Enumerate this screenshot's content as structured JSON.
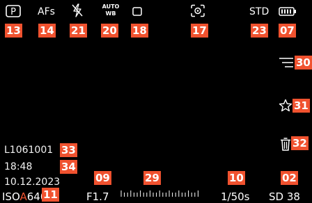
{
  "top_bar": {
    "exposure_mode": "P",
    "focus_mode": "AFs",
    "white_balance_top": "AUTO",
    "white_balance_bottom": "WB",
    "film_style": "STD"
  },
  "right_bar": {
    "menu_icon": "filter-lines-icon",
    "favorite_icon": "star-icon",
    "delete_icon": "trash-icon"
  },
  "bottom_left": {
    "file_name": "L1061001",
    "time": "18:48",
    "date": "10.12.2023"
  },
  "bottom_bar": {
    "iso_prefix": "ISO",
    "iso_auto_marker": "A",
    "iso_value": "640",
    "aperture": "F1.7",
    "shutter_speed": "1/50s",
    "storage": "SD",
    "storage_count": "38"
  },
  "annotations": {
    "b13": "13",
    "b14": "14",
    "b21": "21",
    "b20": "20",
    "b18": "18",
    "b17": "17",
    "b23": "23",
    "b07": "07",
    "b30": "30",
    "b31": "31",
    "b32": "32",
    "b33": "33",
    "b34": "34",
    "b09": "09",
    "b29": "29",
    "b10": "10",
    "b02": "02",
    "b11": "11"
  },
  "colors": {
    "background": "#000000",
    "annotation_badge": "#f0522f",
    "iso_auto_marker": "#f0522f",
    "text": "#ffffff"
  }
}
